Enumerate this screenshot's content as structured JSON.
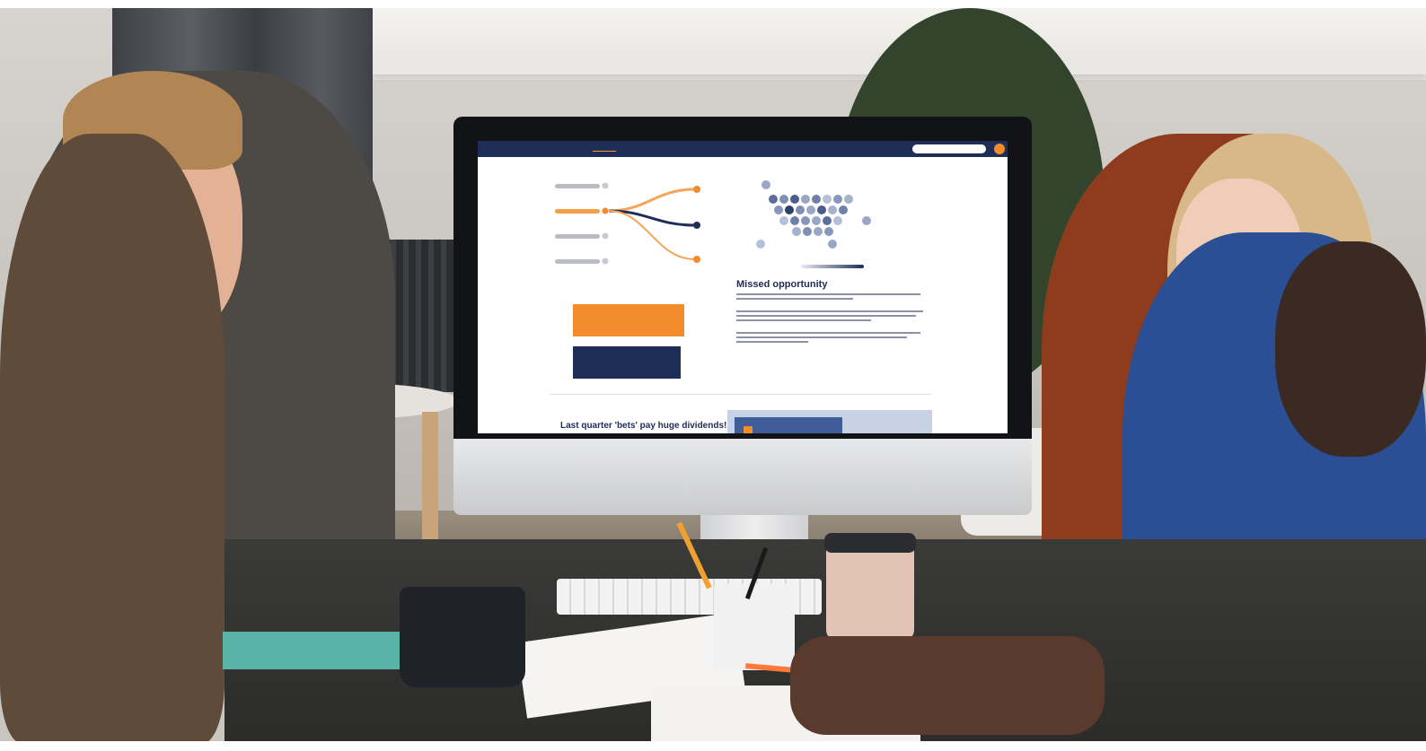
{
  "photo": {
    "subject": "",
    "colors": {
      "accent": "#f28b2c",
      "navy": "#1f2e57"
    }
  },
  "screen": {
    "nav": {
      "logo": "",
      "items": [
        "",
        "",
        "",
        "",
        ""
      ],
      "search_placeholder": ""
    },
    "sankey": {
      "title": "",
      "left_labels": [
        "",
        "",
        "",
        ""
      ],
      "right_labels": [
        "",
        "",
        "",
        ""
      ]
    },
    "hexmap": {
      "title": ""
    },
    "barchart": {
      "title": "",
      "bars": [
        {
          "label": "",
          "value_label": "",
          "color": "#f28b2c"
        },
        {
          "label": "",
          "value_label": "",
          "color": "#1f2e57"
        }
      ]
    },
    "article": {
      "heading": "Missed opportunity"
    },
    "bottom": {
      "headline": "Last quarter 'bets' pay huge dividends!"
    }
  }
}
